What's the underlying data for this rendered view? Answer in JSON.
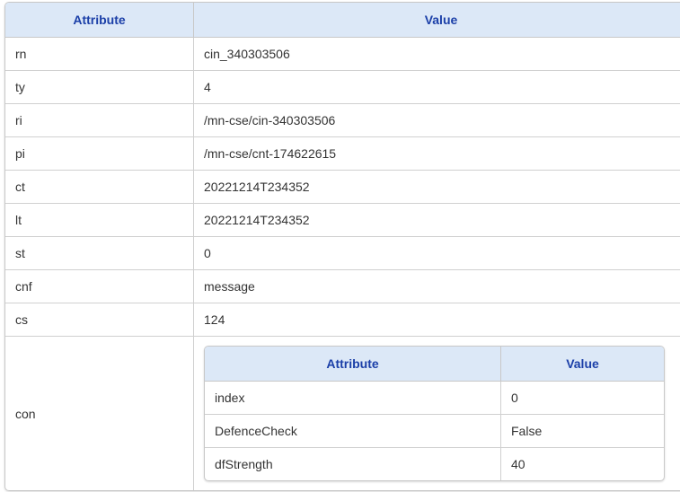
{
  "headers": {
    "attribute": "Attribute",
    "value": "Value"
  },
  "rows": [
    {
      "attr": "rn",
      "value": "cin_340303506"
    },
    {
      "attr": "ty",
      "value": "4"
    },
    {
      "attr": "ri",
      "value": "/mn-cse/cin-340303506"
    },
    {
      "attr": "pi",
      "value": "/mn-cse/cnt-174622615"
    },
    {
      "attr": "ct",
      "value": "20221214T234352"
    },
    {
      "attr": "lt",
      "value": "20221214T234352"
    },
    {
      "attr": "st",
      "value": "0"
    },
    {
      "attr": "cnf",
      "value": "message"
    },
    {
      "attr": "cs",
      "value": "124"
    }
  ],
  "con": {
    "attr": "con",
    "headers": {
      "attribute": "Attribute",
      "value": "Value"
    },
    "rows": [
      {
        "attr": "index",
        "value": "0"
      },
      {
        "attr": "DefenceCheck",
        "value": "False"
      },
      {
        "attr": "dfStrength",
        "value": "40"
      }
    ]
  }
}
